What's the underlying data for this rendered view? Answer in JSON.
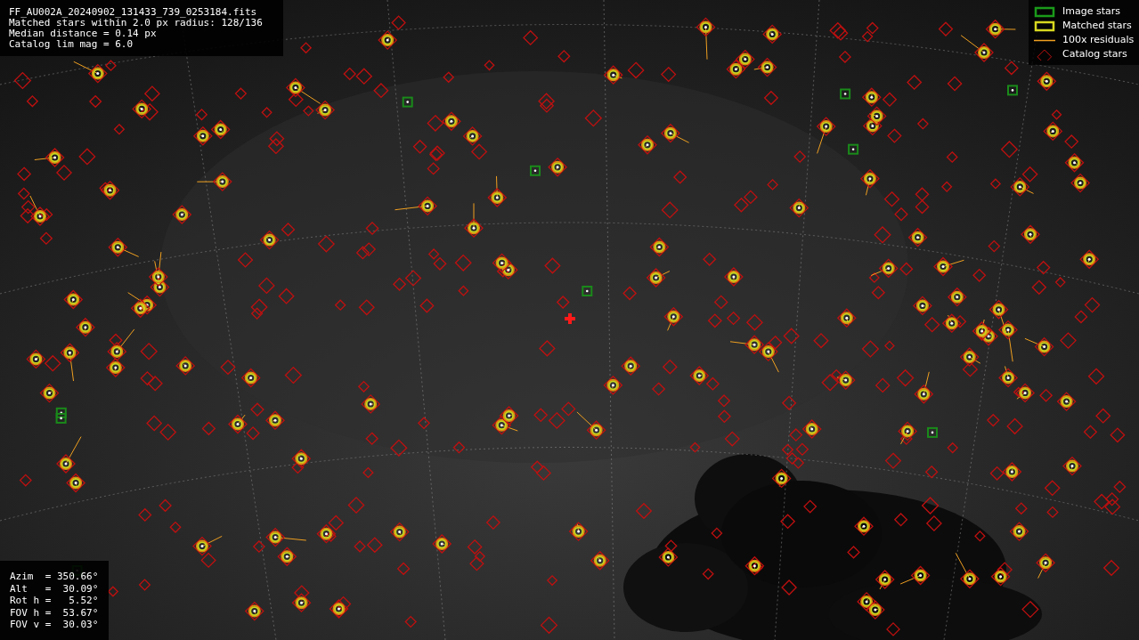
{
  "file_info": {
    "lines": [
      "FF_AU002A_20240902_131433_739_0253184.fits",
      "Matched stars within 2.0 px radius: 128/136",
      "Median distance = 0.14 px",
      "Catalog lim mag = 6.0"
    ]
  },
  "legend": [
    {
      "label": "Image stars"
    },
    {
      "kind": "matched",
      "label": "Matched stars"
    },
    {
      "kind": "residual",
      "label": "100x residuals"
    },
    {
      "kind": "catalog",
      "label": "Catalog stars"
    }
  ],
  "pointing": {
    "lines": [
      "Azim  = 350.66°",
      "Alt   =  30.09°",
      "Rot h =   5.52°",
      "FOV h =  53.67°",
      "FOV v =  30.03°"
    ]
  }
}
